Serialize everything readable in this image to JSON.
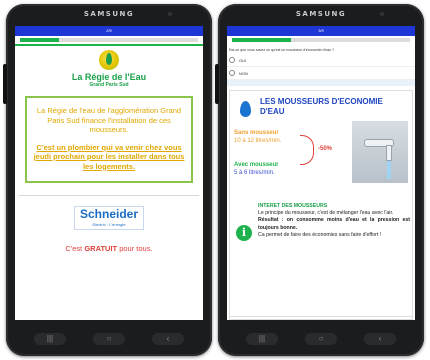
{
  "device": {
    "brand": "SAMSUNG"
  },
  "screen1": {
    "appbar_title": "2/9",
    "progress": 0.22,
    "logo_title": "La Régie de l'Eau",
    "logo_subtitle": "Grand Paris Sud",
    "intro": "La Régie de l'eau de l'agglomération Grand Paris Sud finance l'installation de ces mousseurs.",
    "plumber_text": "C'est un plombier qui va venir chez vous jeudi prochain pour les installer dans tous les logements.",
    "partner_name": "Schneider",
    "partner_tagline": "Electric · L'énergie",
    "gratuit_prefix": "C'est ",
    "gratuit_word": "GRATUIT",
    "gratuit_suffix": " pour tous."
  },
  "screen2": {
    "appbar_title": "3/9",
    "progress": 0.33,
    "question": "Est-ce que vous savez ce qu'est un mousseur d'économie d'eau ?",
    "options": [
      {
        "label": "OUI"
      },
      {
        "label": "NON"
      }
    ],
    "card_title": "LES MOUSSEURS D'ECONOMIE D'EAU",
    "sans_label": "Sans mousseur",
    "sans_value": "10 à 12 litres/min.",
    "avec_label": "Avec mousseur",
    "avec_value": "5 à 6 litres/min.",
    "reduction": "-50%",
    "interet_title": "INTERET DES MOUSSEURS",
    "interet_text": "Le principe du mousseur, c'est de mélanger l'eau avec l'air.",
    "result_text": "Résultat : on consomme moins d'eau et la pression est toujours bonne.",
    "closing_text": "Ca permet de faire des économies sans faire d'effort !"
  },
  "colors": {
    "appbar": "#1e36d6",
    "progress_fill": "#1db24b",
    "frame": "#8ac44a",
    "text_orange": "#e0a800",
    "accent_red": "#e0413a",
    "title_blue": "#1e44c0"
  },
  "icons": [
    "leaf-drop-logo-icon",
    "water-drop-icon",
    "info-icon",
    "faucet-photo"
  ]
}
